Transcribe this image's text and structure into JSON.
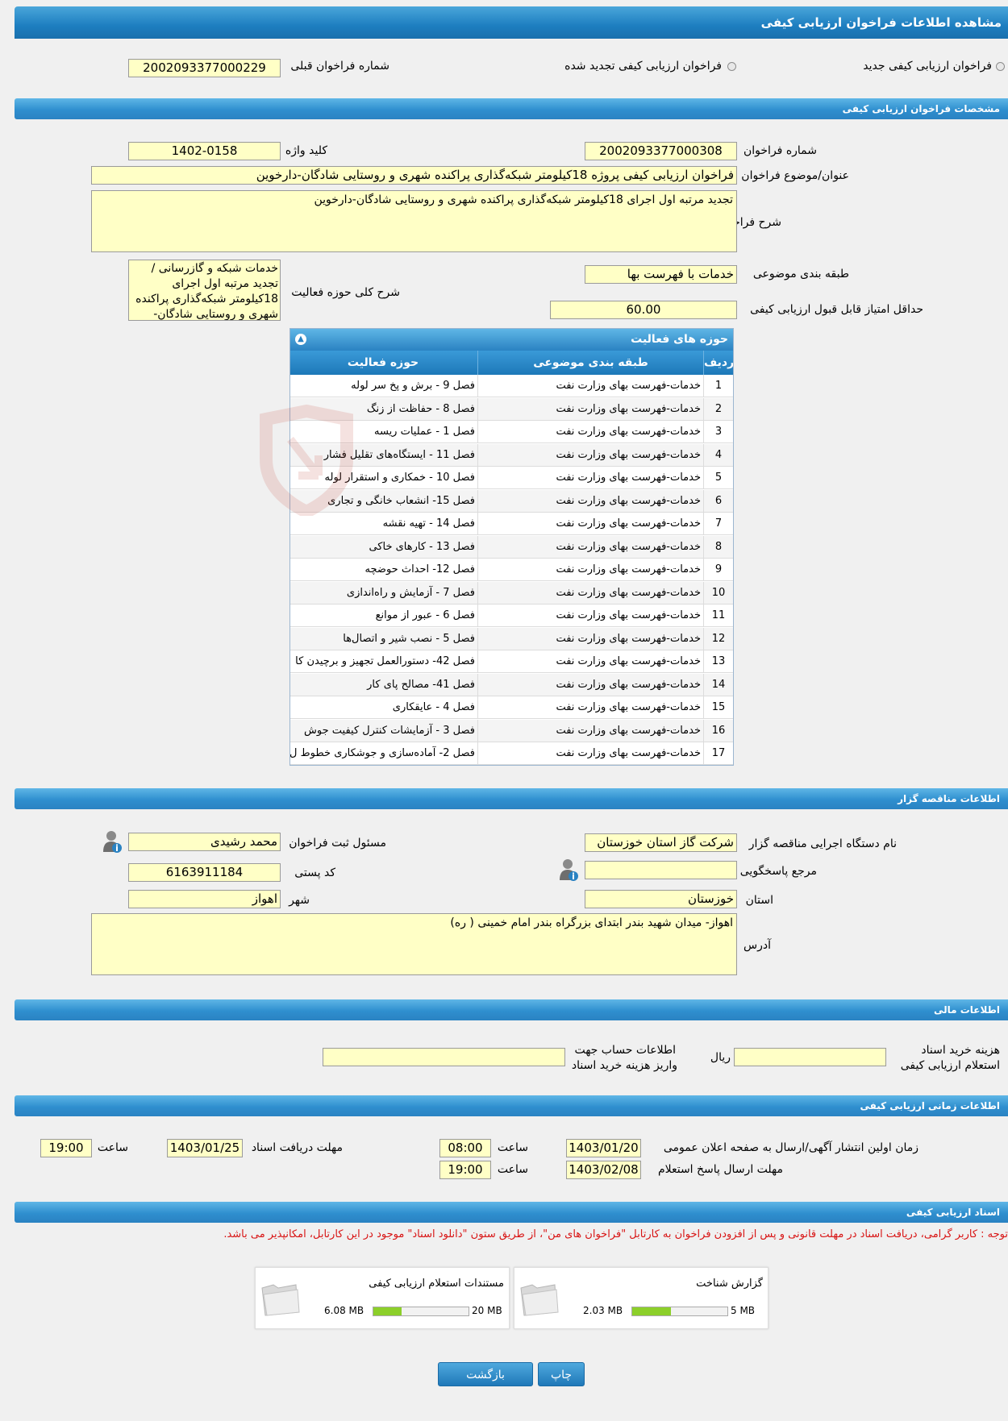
{
  "page": {
    "title": "مشاهده اطلاعات فراخوان ارزیابی کیفی"
  },
  "call_type": {
    "new_label": "فراخوان ارزیابی کیفی جدید",
    "renewed_label": "فراخوان ارزیابی کیفی تجدید شده",
    "previous_number_label": "شماره فراخوان قبلی",
    "previous_number": "2002093377000229"
  },
  "specs": {
    "section_title": "مشخصات فراخوان ارزیابی کیفی",
    "call_number_label": "شماره فراخوان",
    "call_number": "2002093377000308",
    "keyword_label": "کلید واژه",
    "keyword": "1402-0158",
    "subject_label": "عنوان/موضوع فراخوان",
    "subject": "فراخوان ارزیابی کیفی پروژه 18کیلومتر شبکه‌گذاری پراکنده شهری و روستایی  شادگان-دارخوین",
    "description_label": "شرح فراخوان",
    "description": "تجدید مرتبه اول اجرای 18کیلومتر شبکه‌گذاری پراکنده شهری و روستایی  شادگان-دارخوین",
    "category_label": "طبقه بندی موضوعی",
    "category": "خدمات با فهرست بها",
    "activity_desc_label": "شرح کلی حوزه فعالیت",
    "activity_desc": "خدمات شبکه و گازرسانی / تجدید مرتبه اول اجرای 18کیلومتر شبکه‌گذاری پراکنده شهری و روستایی  شادگان-",
    "min_score_label": "حداقل امتیاز قابل قبول ارزیابی کیفی",
    "min_score": "60.00"
  },
  "activities": {
    "title": "حوزه های فعالیت",
    "headers": {
      "idx": "رديف",
      "category": "طبقه بندی موضوعی",
      "activity": "حوزه فعالیت"
    },
    "rows": [
      {
        "idx": "1",
        "category": "خدمات-فهرست بهای وزارت نفت",
        "activity": "فصل 9 - برش و پخ سر لوله"
      },
      {
        "idx": "2",
        "category": "خدمات-فهرست بهای وزارت نفت",
        "activity": "فصل 8 - حفاظت از زنگ"
      },
      {
        "idx": "3",
        "category": "خدمات-فهرست بهای وزارت نفت",
        "activity": "فصل 1 - عملیات ریسه"
      },
      {
        "idx": "4",
        "category": "خدمات-فهرست بهای وزارت نفت",
        "activity": "فصل 11 - ایستگاه‌های تقلیل فشار"
      },
      {
        "idx": "5",
        "category": "خدمات-فهرست بهای وزارت نفت",
        "activity": "فصل 10 - خمکاری و استقرار لوله"
      },
      {
        "idx": "6",
        "category": "خدمات-فهرست بهای وزارت نفت",
        "activity": "فصل 15- انشعاب خانگی و تجاری"
      },
      {
        "idx": "7",
        "category": "خدمات-فهرست بهای وزارت نفت",
        "activity": "فصل 14 - تهیه نقشه"
      },
      {
        "idx": "8",
        "category": "خدمات-فهرست بهای وزارت نفت",
        "activity": "فصل 13 - کارهای خاکی"
      },
      {
        "idx": "9",
        "category": "خدمات-فهرست بهای وزارت نفت",
        "activity": "فصل 12- احداث حوضچه"
      },
      {
        "idx": "10",
        "category": "خدمات-فهرست بهای وزارت نفت",
        "activity": "فصل 7 - آزمایش و راه‌اندازی"
      },
      {
        "idx": "11",
        "category": "خدمات-فهرست بهای وزارت نفت",
        "activity": "فصل 6 - عبور از موانع"
      },
      {
        "idx": "12",
        "category": "خدمات-فهرست بهای وزارت نفت",
        "activity": "فصل 5 - نصب شیر و اتصال‌ها"
      },
      {
        "idx": "13",
        "category": "خدمات-فهرست بهای وزارت نفت",
        "activity": "فصل 42- دستورالعمل تجهیز و برچیدن کا"
      },
      {
        "idx": "14",
        "category": "خدمات-فهرست بهای وزارت نفت",
        "activity": "فصل 41- مصالح پای کار"
      },
      {
        "idx": "15",
        "category": "خدمات-فهرست بهای وزارت نفت",
        "activity": "فصل 4 - عایقکاری"
      },
      {
        "idx": "16",
        "category": "خدمات-فهرست بهای وزارت نفت",
        "activity": "فصل 3 - آزمایشات کنترل کیفیت جوش"
      },
      {
        "idx": "17",
        "category": "خدمات-فهرست بهای وزارت نفت",
        "activity": "فصل 2- آماده‌سازی و جوشکاری خطوط ل"
      }
    ]
  },
  "tenderer": {
    "section_title": "اطلاعات مناقصه گزار",
    "org_label": "نام دستگاه اجرایی مناقصه گزار",
    "org": "شرکت گاز استان خوزستان",
    "registrar_label": "مسئول ثبت فراخوان",
    "registrar": "محمد رشیدی",
    "responder_label": "مرجع پاسخگویی",
    "responder": "",
    "postal_label": "کد پستی",
    "postal": "6163911184",
    "province_label": "استان",
    "province": "خوزستان",
    "city_label": "شهر",
    "city": "اهواز",
    "address_label": "آدرس",
    "address": "اهواز- میدان شهید بندر ابتدای بزرگراه بندر امام خمینی ( ره)"
  },
  "finance": {
    "section_title": "اطلاعات مالی",
    "fee_label_1": "هزینه خرید اسناد",
    "fee_label_2": "استعلام ارزیابی کیفی",
    "fee": "",
    "currency": "ریال",
    "account_label_1": "اطلاعات حساب جهت",
    "account_label_2": "واریز هزینه خرید اسناد",
    "account": ""
  },
  "timing": {
    "section_title": "اطلاعات زمانی ارزیابی کیفی",
    "publish_label": "زمان اولین انتشار آگهی/ارسال به صفحه اعلان عمومی",
    "publish_date": "1403/01/20",
    "publish_time": "08:00",
    "deadline_docs_label": "مهلت دریافت اسناد",
    "deadline_docs_date": "1403/01/25",
    "deadline_docs_time": "19:00",
    "deadline_reply_label": "مهلت ارسال پاسخ استعلام",
    "deadline_reply_date": "1403/02/08",
    "deadline_reply_time": "19:00",
    "time_label": "ساعت"
  },
  "documents": {
    "section_title": "اسناد ارزیابی کیفی",
    "notice": "توجه : کاربر گرامی، دریافت اسناد در مهلت قانونی و پس از افزودن فراخوان به کارتابل \"فراخوان های من\"، از طریق ستون \"دانلود اسناد\" موجود در این کارتابل، امکانپذیر می باشد.",
    "notice_color": "#d81414",
    "files": [
      {
        "name": "گزارش شناخت",
        "size": "2.03 MB",
        "max": "5 MB",
        "fill": 0.41
      },
      {
        "name": "مستندات استعلام ارزیابی کیفی",
        "size": "6.08 MB",
        "max": "20 MB",
        "fill": 0.3
      }
    ]
  },
  "actions": {
    "print_label": "چاپ",
    "back_label": "بازگشت"
  },
  "colors": {
    "header_blue": "#1d7ec0",
    "field_yellow": "#ffffc6",
    "progress_green": "#8ccf2a"
  }
}
